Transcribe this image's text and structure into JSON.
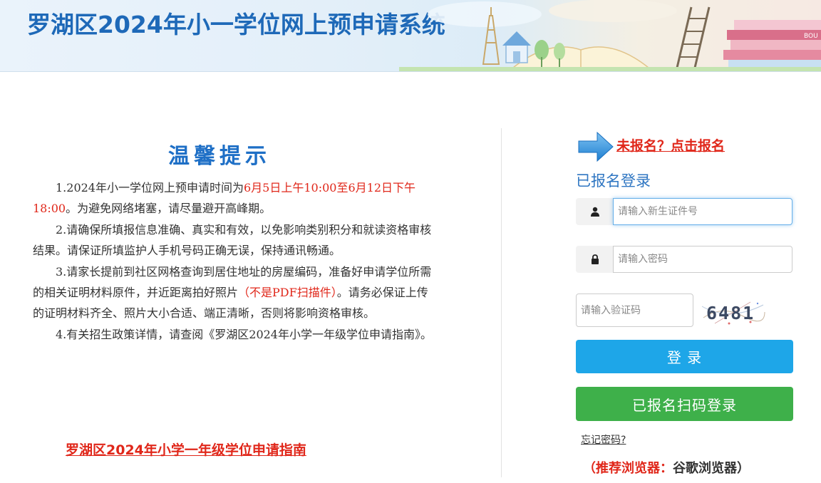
{
  "header": {
    "title": "罗湖区2024年小一学位网上预申请系统",
    "banner_text": "BOU"
  },
  "notice": {
    "title": "温馨提示",
    "items": [
      {
        "prefix": "1.2024年小一学位网上预申请时间为",
        "highlight": "6月5日上午10:00至6月12日下午18:00",
        "suffix": "。为避免网络堵塞，请尽量避开高峰期。"
      },
      {
        "text": "2.请确保所填报信息准确、真实和有效，以免影响类别积分和就读资格审核结果。请保证所填监护人手机号码正确无误，保持通讯畅通。"
      },
      {
        "prefix": "3.请家长提前到社区网格查询到居住地址的房屋编码，准备好申请学位所需的相关证明材料原件，并近距离拍好照片",
        "highlight": "（不是PDF扫描件）",
        "suffix": "。请务必保证上传的证明材料齐全、照片大小合适、端正清晰，否则将影响资格审核。"
      },
      {
        "text": "4.有关招生政策详情，请查阅《罗湖区2024年小学一年级学位申请指南》。"
      }
    ],
    "guide_link": "罗湖区2024年小学一年级学位申请指南"
  },
  "login": {
    "register_link": "未报名？点击报名",
    "title": "已报名登录",
    "id_placeholder": "请输入新生证件号",
    "password_placeholder": "请输入密码",
    "captcha_placeholder": "请输入验证码",
    "captcha_text": "6481",
    "login_button": "登 录",
    "scan_button": "已报名扫码登录",
    "forgot_link": "忘记密码?",
    "browser_label": "（推荐浏览器：",
    "browser_value": "谷歌浏览器）"
  },
  "icons": {
    "id_field": "user-icon",
    "password_field": "lock-icon",
    "register": "arrow-right-icon"
  },
  "colors": {
    "primary_blue": "#1e69b8",
    "alert_red": "#e0271a",
    "login_button": "#1ea6e8",
    "scan_button": "#3eb04a"
  }
}
